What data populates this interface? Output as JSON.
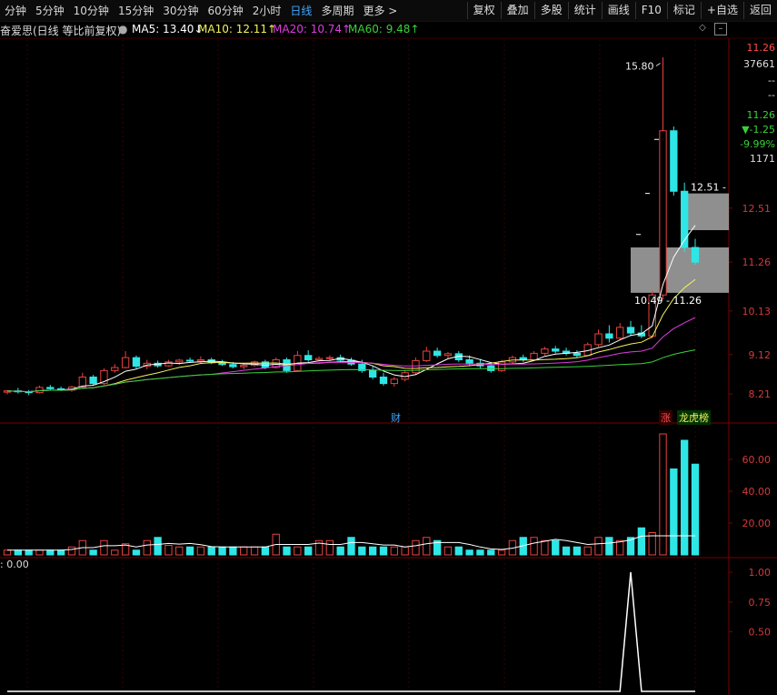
{
  "toolbar": {
    "periods": [
      "分钟",
      "5分钟",
      "10分钟",
      "15分钟",
      "30分钟",
      "60分钟",
      "2小时",
      "日线",
      "多周期",
      "更多 >"
    ],
    "active_period": "日线",
    "buttons": [
      "复权",
      "叠加",
      "多股",
      "统计",
      "画线",
      "F10",
      "标记",
      "+自选",
      "返回"
    ]
  },
  "info": {
    "stock_title": "奋爱思(日线 等比前复权)",
    "ma5": "MA5: 13.40↓",
    "ma10": "MA10: 12.11↑",
    "ma20": "MA20: 10.74↑",
    "ma60": "MA60: 9.48↑"
  },
  "right_panel": {
    "price": "11.26",
    "volume": "37661",
    "dash1": "--",
    "dash2": "--",
    "dash3": "--",
    "last": "11.26",
    "change": "▼-1.25",
    "change_pct": "-9.99%",
    "turnover": "1171"
  },
  "price_axis": [
    "12.51",
    "11.26",
    "10.13",
    "9.12",
    "8.21"
  ],
  "volume_axis": [
    "60.00",
    "40.00",
    "20.00"
  ],
  "indicator_axis": [
    "1.00",
    "0.75",
    "0.50"
  ],
  "annotations": {
    "high": "15.80",
    "zone_top": "12.51 -",
    "zone_bottom": "10.49 - 11.26",
    "cai": "财",
    "zhang": "涨",
    "lhb": "龙虎榜",
    "indicator_value": ": 0.00"
  },
  "colors": {
    "up": "#e8433f",
    "down": "#2ee6e6",
    "ma5": "#ffffff",
    "ma10": "#f3f35a",
    "ma20": "#e03ce0",
    "ma60": "#3ad13a",
    "active_tab": "#3ea6ff"
  },
  "chart_data": {
    "type": "candlestick",
    "price_ylim": [
      7.6,
      16.4
    ],
    "candles": [
      [
        8.25,
        8.3,
        8.2,
        8.28
      ],
      [
        8.28,
        8.35,
        8.22,
        8.26
      ],
      [
        8.26,
        8.3,
        8.18,
        8.24
      ],
      [
        8.24,
        8.4,
        8.22,
        8.36
      ],
      [
        8.36,
        8.42,
        8.3,
        8.33
      ],
      [
        8.33,
        8.38,
        8.28,
        8.3
      ],
      [
        8.3,
        8.4,
        8.26,
        8.37
      ],
      [
        8.37,
        8.7,
        8.35,
        8.6
      ],
      [
        8.6,
        8.65,
        8.4,
        8.45
      ],
      [
        8.45,
        8.8,
        8.42,
        8.75
      ],
      [
        8.75,
        8.9,
        8.7,
        8.82
      ],
      [
        8.82,
        9.2,
        8.8,
        9.05
      ],
      [
        9.05,
        9.1,
        8.8,
        8.85
      ],
      [
        8.85,
        9.0,
        8.78,
        8.92
      ],
      [
        8.92,
        8.98,
        8.82,
        8.86
      ],
      [
        8.86,
        9.0,
        8.84,
        8.95
      ],
      [
        8.95,
        9.02,
        8.88,
        8.99
      ],
      [
        8.99,
        9.05,
        8.94,
        8.97
      ],
      [
        8.97,
        9.08,
        8.92,
        9.0
      ],
      [
        9.0,
        9.05,
        8.9,
        8.93
      ],
      [
        8.93,
        9.0,
        8.86,
        8.89
      ],
      [
        8.89,
        8.95,
        8.8,
        8.84
      ],
      [
        8.84,
        8.92,
        8.78,
        8.87
      ],
      [
        8.87,
        8.98,
        8.84,
        8.95
      ],
      [
        8.95,
        9.0,
        8.78,
        8.82
      ],
      [
        8.82,
        9.05,
        8.8,
        9.0
      ],
      [
        9.0,
        9.05,
        8.7,
        8.75
      ],
      [
        8.75,
        9.2,
        8.72,
        9.1
      ],
      [
        9.1,
        9.22,
        8.95,
        9.0
      ],
      [
        9.0,
        9.08,
        8.96,
        9.03
      ],
      [
        9.03,
        9.1,
        8.98,
        9.05
      ],
      [
        9.05,
        9.12,
        8.95,
        8.99
      ],
      [
        8.99,
        9.05,
        8.86,
        8.9
      ],
      [
        8.9,
        9.0,
        8.7,
        8.75
      ],
      [
        8.75,
        8.85,
        8.55,
        8.6
      ],
      [
        8.6,
        8.7,
        8.4,
        8.45
      ],
      [
        8.45,
        8.6,
        8.38,
        8.55
      ],
      [
        8.55,
        8.75,
        8.5,
        8.7
      ],
      [
        8.7,
        9.05,
        8.65,
        8.98
      ],
      [
        8.98,
        9.3,
        8.95,
        9.2
      ],
      [
        9.2,
        9.28,
        9.05,
        9.1
      ],
      [
        9.1,
        9.18,
        9.02,
        9.14
      ],
      [
        9.14,
        9.2,
        8.95,
        9.0
      ],
      [
        9.0,
        9.1,
        8.85,
        8.92
      ],
      [
        8.92,
        9.02,
        8.8,
        8.86
      ],
      [
        8.86,
        8.95,
        8.7,
        8.75
      ],
      [
        8.75,
        9.0,
        8.72,
        8.95
      ],
      [
        8.95,
        9.1,
        8.9,
        9.05
      ],
      [
        9.05,
        9.12,
        8.95,
        9.0
      ],
      [
        9.0,
        9.2,
        8.98,
        9.15
      ],
      [
        9.15,
        9.3,
        9.1,
        9.25
      ],
      [
        9.25,
        9.32,
        9.15,
        9.2
      ],
      [
        9.2,
        9.28,
        9.1,
        9.15
      ],
      [
        9.15,
        9.22,
        9.05,
        9.1
      ],
      [
        9.1,
        9.4,
        9.08,
        9.35
      ],
      [
        9.35,
        9.7,
        9.3,
        9.6
      ],
      [
        9.6,
        9.8,
        9.4,
        9.5
      ],
      [
        9.5,
        9.85,
        9.45,
        9.75
      ],
      [
        9.75,
        9.9,
        9.55,
        9.62
      ],
      [
        9.62,
        9.8,
        9.5,
        9.55
      ],
      [
        9.55,
        10.6,
        9.5,
        10.5
      ],
      [
        10.5,
        16.0,
        10.4,
        14.3
      ],
      [
        14.3,
        14.4,
        12.8,
        12.9
      ],
      [
        12.9,
        13.1,
        11.5,
        11.6
      ],
      [
        11.6,
        11.8,
        11.2,
        11.26
      ]
    ],
    "volumes": [
      3,
      3,
      3,
      3,
      3,
      3,
      5,
      9,
      3,
      9,
      3,
      7,
      3,
      9,
      11,
      6,
      5,
      5,
      5,
      5,
      5,
      5,
      5,
      5,
      5,
      13,
      5,
      5,
      5,
      9,
      9,
      5,
      11,
      5,
      5,
      5,
      5,
      5,
      9,
      11,
      9,
      5,
      5,
      3,
      3,
      3,
      3,
      9,
      11,
      11,
      9,
      9,
      5,
      5,
      5,
      11,
      11,
      9,
      11,
      17,
      14,
      76,
      54,
      72,
      57
    ],
    "indicator": [
      0,
      0,
      0,
      0,
      0,
      0,
      0,
      0,
      0,
      0,
      0,
      0,
      0,
      0,
      0,
      0,
      0,
      0,
      0,
      0,
      0,
      0,
      0,
      0,
      0,
      0,
      0,
      0,
      0,
      0,
      0,
      0,
      0,
      0,
      0,
      0,
      0,
      0,
      0,
      0,
      0,
      0,
      0,
      0,
      0,
      0,
      0,
      0,
      0,
      0,
      0,
      0,
      0,
      0,
      0,
      0,
      0,
      0,
      1,
      0,
      0,
      0,
      0,
      0,
      0
    ],
    "volume_ylim": [
      0,
      80
    ],
    "indicator_ylim": [
      0,
      1.1
    ]
  }
}
